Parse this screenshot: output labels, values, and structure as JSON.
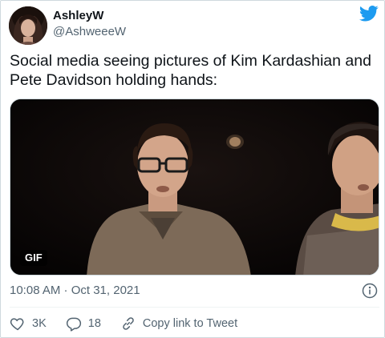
{
  "author": {
    "display_name": "AshleyW",
    "handle": "@AshweeeW"
  },
  "brand_icon": "twitter-bird-icon",
  "colors": {
    "twitter_blue": "#1d9bf0",
    "secondary_text": "#536471",
    "primary_text": "#0f1419",
    "border": "#cfd9de"
  },
  "tweet": {
    "text": "Social media seeing pictures of Kim Kardashian and Pete Davidson holding hands:",
    "media_badge": "GIF",
    "timestamp": "10:08 AM · Oct 31, 2021"
  },
  "actions": {
    "likes": "3K",
    "replies": "18",
    "copy_link_label": "Copy link to Tweet"
  },
  "icons": {
    "like": "heart-icon",
    "reply": "reply-bubble-icon",
    "copy_link": "link-icon",
    "info": "info-icon"
  }
}
